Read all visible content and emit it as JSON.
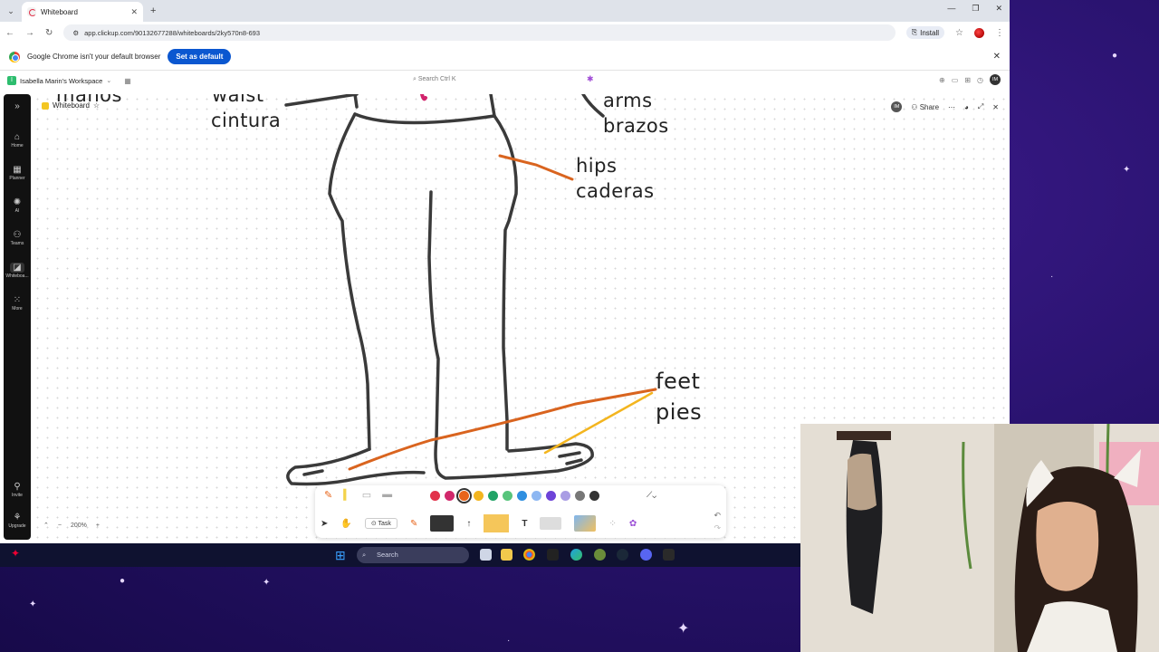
{
  "browser": {
    "tab_title": "Whiteboard",
    "url": "app.clickup.com/90132677288/whiteboards/2ky570n8-693",
    "install_label": "Install",
    "default_message": "Google Chrome isn't your default browser",
    "set_default_label": "Set as default"
  },
  "clickup": {
    "workspace_name": "Isabella Marin's Workspace",
    "search_placeholder": "Search",
    "search_shortcut": "Ctrl K",
    "avatar_initials": "IM",
    "rail": [
      {
        "label": "Home",
        "icon": "home-icon"
      },
      {
        "label": "Planner",
        "icon": "calendar-icon"
      },
      {
        "label": "AI",
        "icon": "ai-icon"
      },
      {
        "label": "Teams",
        "icon": "teams-icon"
      },
      {
        "label": "Whiteboa...",
        "icon": "whiteboard-icon"
      },
      {
        "label": "More",
        "icon": "grid-icon"
      },
      {
        "label": "Invite",
        "icon": "invite-icon"
      },
      {
        "label": "Upgrade",
        "icon": "upgrade-icon"
      }
    ]
  },
  "whiteboard": {
    "title": "Whiteboard",
    "share_label": "Share",
    "share_avatar": "IM",
    "zoom_level": "200%",
    "labels": {
      "top_left": "manos",
      "waist": "waist",
      "cintura": "cintura",
      "arms": "arms",
      "brazos": "brazos",
      "hips": "hips",
      "caderas": "caderas",
      "feet": "feet",
      "pies": "pies"
    },
    "palette": [
      "#e2324a",
      "#d1286b",
      "#e8641a",
      "#f3b51f",
      "#21a366",
      "#58c47c",
      "#2f8fe0",
      "#8db7f2",
      "#6d43d8",
      "#a99de4",
      "#777777",
      "#333333"
    ],
    "selected_color": "#e8641a",
    "tools": {
      "task_label": "Task",
      "text_label": "T"
    }
  },
  "taskbar": {
    "search_label": "Search"
  }
}
